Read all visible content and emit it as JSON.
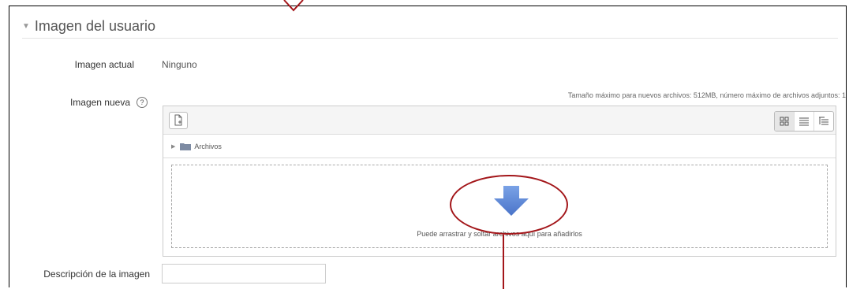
{
  "section": {
    "toggle_icon": "triangle-down-icon",
    "title": "Imagen del usuario"
  },
  "current_image": {
    "label": "Imagen actual",
    "value": "Ninguno"
  },
  "new_image": {
    "label": "Imagen nueva",
    "help_icon": "question-circle-icon",
    "file_limits": "Tamaño máximo para nuevos archivos: 512MB, número máximo de archivos adjuntos: 1"
  },
  "filepicker": {
    "add_icon": "add-file-icon",
    "view_icons": [
      "grid-view-icon",
      "list-view-icon",
      "tree-view-icon"
    ],
    "path_label": "Archivos",
    "drop_text": "Puede arrastrar y soltar archivos aquí para añadirlos",
    "arrow_color": "#5b86d6"
  },
  "description": {
    "label": "Descripción de la imagen",
    "value": ""
  },
  "annotation_color": "#a3161a"
}
